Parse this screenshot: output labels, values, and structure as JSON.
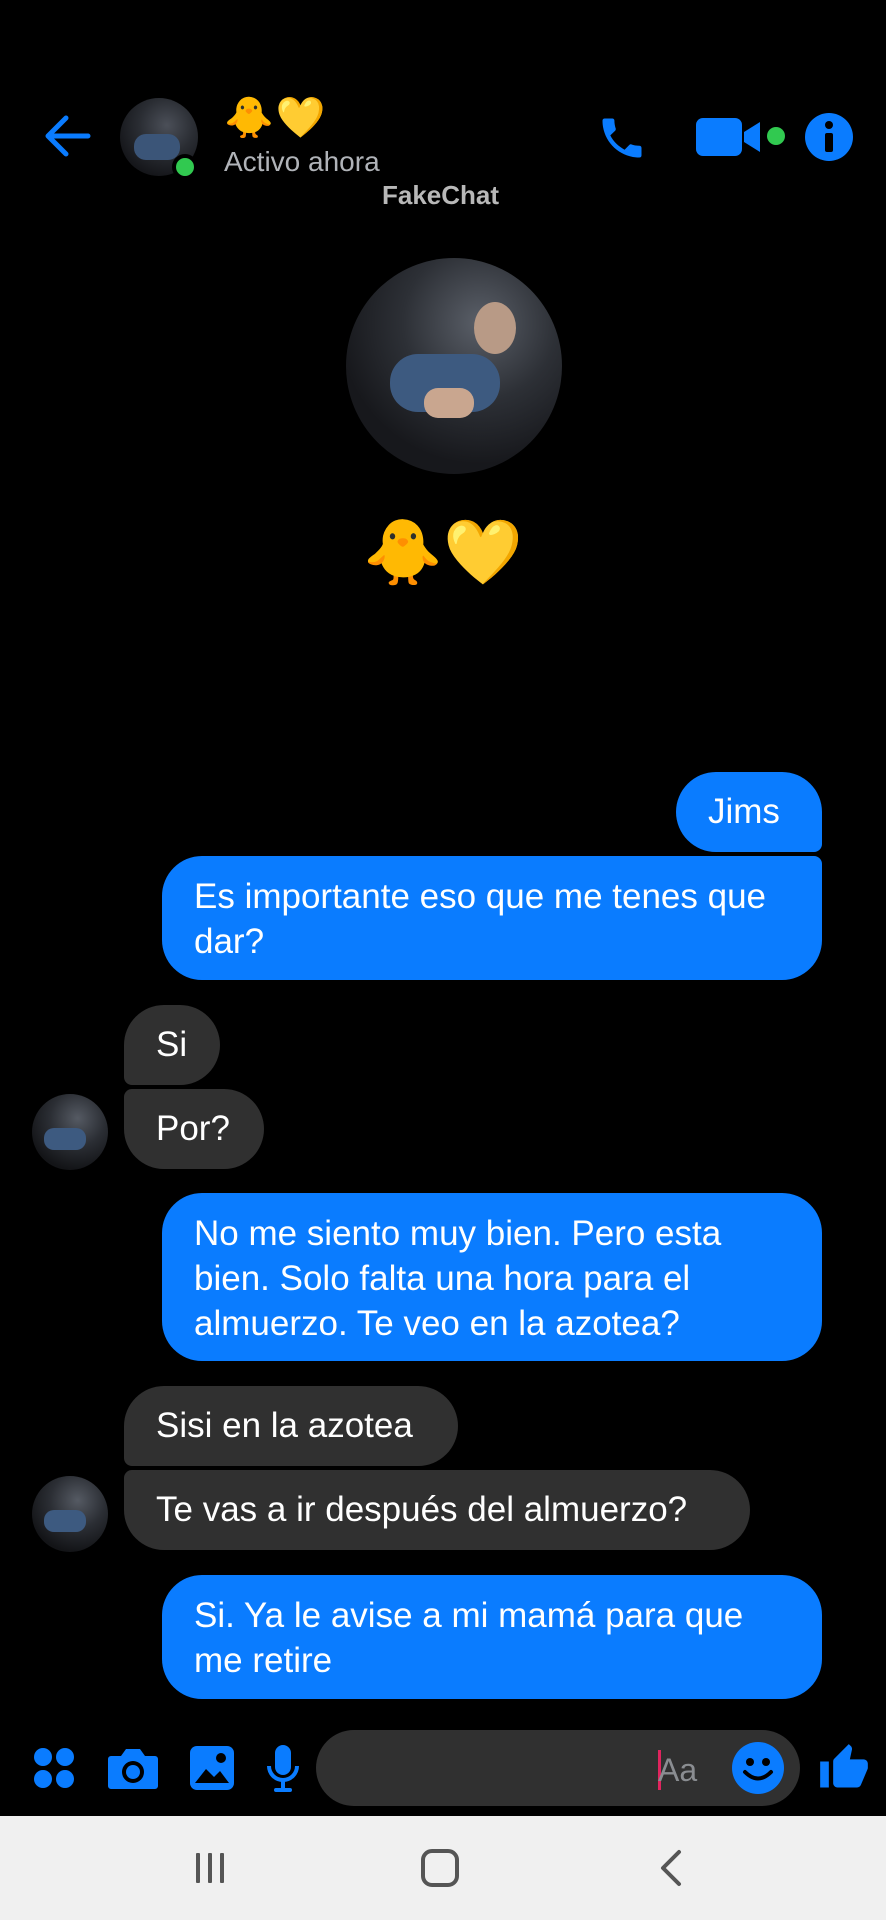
{
  "header": {
    "contact_name": "🐥💛",
    "status": "Activo ahora",
    "watermark": "FakeChat"
  },
  "profile": {
    "name": "🐥💛"
  },
  "messages": [
    {
      "direction": "outgoing",
      "text": "Jims"
    },
    {
      "direction": "outgoing",
      "text": "Es importante eso que me tenes que dar?"
    },
    {
      "direction": "incoming",
      "text": "Si"
    },
    {
      "direction": "incoming",
      "text": "Por?"
    },
    {
      "direction": "outgoing",
      "text": "No me siento muy bien. Pero esta bien. Solo falta una hora para el almuerzo. Te veo en la azotea?"
    },
    {
      "direction": "incoming",
      "text": "Sisi en la azotea"
    },
    {
      "direction": "incoming",
      "text": "Te vas a ir después del almuerzo?"
    },
    {
      "direction": "outgoing",
      "text": "Si. Ya le avise a mi mamá para que me retire"
    }
  ],
  "composer": {
    "placeholder": "Aa"
  },
  "colors": {
    "accent": "#0a7cff",
    "incoming_bubble": "#303030",
    "online": "#31c950",
    "background": "#000000"
  },
  "icons": {
    "back": "arrow-left-icon",
    "call": "phone-icon",
    "video": "video-camera-icon",
    "info": "info-icon",
    "apps": "four-dots-icon",
    "camera": "camera-icon",
    "gallery": "image-icon",
    "mic": "microphone-icon",
    "emoji": "smiley-icon",
    "like": "thumbs-up-icon"
  }
}
